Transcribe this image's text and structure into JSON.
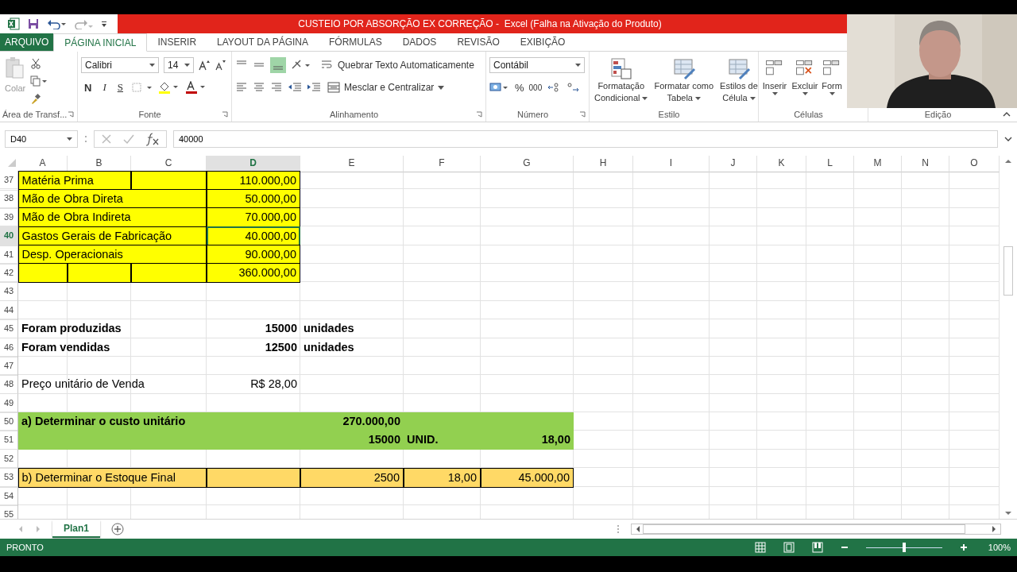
{
  "title_bar": {
    "title": "CUSTEIO POR ABSORÇÃO EX CORREÇÃO -  Excel (Falha na Ativação do Produto)"
  },
  "ribbon_tabs": [
    {
      "label": "ARQUIVO",
      "kind": "file",
      "selected": false
    },
    {
      "label": "PÁGINA INICIAL",
      "kind": "tab",
      "selected": true
    },
    {
      "label": "INSERIR",
      "kind": "tab",
      "selected": false
    },
    {
      "label": "LAYOUT DA PÁGINA",
      "kind": "tab",
      "selected": false
    },
    {
      "label": "FÓRMULAS",
      "kind": "tab",
      "selected": false
    },
    {
      "label": "DADOS",
      "kind": "tab",
      "selected": false
    },
    {
      "label": "REVISÃO",
      "kind": "tab",
      "selected": false
    },
    {
      "label": "EXIBIÇÃO",
      "kind": "tab",
      "selected": false
    }
  ],
  "ribbon": {
    "clipboard": {
      "paste": "Colar",
      "label": "Área de Transf..."
    },
    "font": {
      "name": "Calibri",
      "size": "14",
      "bold": "N",
      "italic": "I",
      "underline": "S",
      "label": "Fonte"
    },
    "alignment": {
      "wrap": "Quebrar Texto Automaticamente",
      "merge": "Mesclar e Centralizar",
      "label": "Alinhamento"
    },
    "number": {
      "format": "Contábil",
      "percent": "%",
      "thousands": "000",
      "label": "Número"
    },
    "styles": {
      "buttons": [
        {
          "line1": "Formatação",
          "line2": "Condicional"
        },
        {
          "line1": "Formatar como",
          "line2": "Tabela"
        },
        {
          "line1": "Estilos de",
          "line2": "Célula"
        }
      ],
      "label": "Estilo"
    },
    "cells": {
      "buttons": [
        "Inserir",
        "Excluir",
        "Form"
      ],
      "label": "Células"
    },
    "editing": {
      "label": "Edição"
    }
  },
  "formula_bar": {
    "name_box": "D40",
    "formula": "40000"
  },
  "sheet": {
    "columns": [
      {
        "label": "A",
        "selected": false
      },
      {
        "label": "B",
        "selected": false
      },
      {
        "label": "C",
        "selected": false
      },
      {
        "label": "D",
        "selected": true
      },
      {
        "label": "E",
        "selected": false
      },
      {
        "label": "F",
        "selected": false
      },
      {
        "label": "G",
        "selected": false
      },
      {
        "label": "H",
        "selected": false
      },
      {
        "label": "I",
        "selected": false
      },
      {
        "label": "J",
        "selected": false
      },
      {
        "label": "K",
        "selected": false
      },
      {
        "label": "L",
        "selected": false
      },
      {
        "label": "M",
        "selected": false
      },
      {
        "label": "N",
        "selected": false
      },
      {
        "label": "O",
        "selected": false
      }
    ],
    "rows": [
      {
        "number": "37",
        "selected": false,
        "cells": [
          {
            "text": "Matéria Prima",
            "kind": "text",
            "color": "#ffff00",
            "border": true
          },
          {
            "merged": true
          },
          {
            "color": "#ffff00",
            "border": true
          },
          {
            "text": "110.000,00",
            "kind": "number",
            "color": "#ffff00",
            "border": true
          }
        ]
      },
      {
        "number": "38",
        "selected": false,
        "cells": [
          {
            "text": "Mão de Obra Direta",
            "kind": "text",
            "color": "#ffff00",
            "border": true
          },
          {
            "merged": true
          },
          {
            "merged": true
          },
          {
            "text": "50.000,00",
            "kind": "number",
            "color": "#ffff00",
            "border": true
          }
        ]
      },
      {
        "number": "39",
        "selected": false,
        "cells": [
          {
            "text": "Mão de Obra Indireta",
            "kind": "text",
            "color": "#ffff00",
            "border": true
          },
          {
            "merged": true
          },
          {
            "merged": true
          },
          {
            "text": "70.000,00",
            "kind": "number",
            "color": "#ffff00",
            "border": true
          }
        ]
      },
      {
        "number": "40",
        "selected": true,
        "cells": [
          {
            "text": "Gastos Gerais de Fabricação",
            "kind": "text",
            "color": "#ffff00",
            "border": true
          },
          {
            "merged": true
          },
          {
            "merged": true
          },
          {
            "text": "40.000,00",
            "kind": "number",
            "color": "#ffff00",
            "border": true
          }
        ]
      },
      {
        "number": "41",
        "selected": false,
        "cells": [
          {
            "text": "Desp. Operacionais",
            "kind": "text",
            "color": "#ffff00",
            "border": true
          },
          {
            "merged": true
          },
          {
            "merged": true
          },
          {
            "text": "90.000,00",
            "kind": "number",
            "color": "#ffff00",
            "border": true
          }
        ]
      },
      {
        "number": "42",
        "selected": false,
        "cells": [
          {
            "color": "#ffff00",
            "border": true
          },
          {
            "color": "#ffff00",
            "border": true
          },
          {
            "color": "#ffff00",
            "border": true
          },
          {
            "text": "360.000,00",
            "kind": "number",
            "color": "#ffff00",
            "border": true
          }
        ]
      },
      {
        "number": "43",
        "selected": false
      },
      {
        "number": "44",
        "selected": false
      },
      {
        "number": "45",
        "selected": false,
        "cells": [
          {
            "text": "Foram produzidas",
            "kind": "text",
            "bold": true
          },
          {
            "merged": true
          },
          {
            "merged": true
          },
          {
            "text": "15000",
            "kind": "number",
            "bold": true
          },
          {
            "text": "unidades",
            "kind": "text",
            "bold": true
          }
        ]
      },
      {
        "number": "46",
        "selected": false,
        "cells": [
          {
            "text": "Foram vendidas",
            "kind": "text",
            "bold": true
          },
          {
            "merged": true
          },
          {
            "merged": true
          },
          {
            "text": "12500",
            "kind": "number",
            "bold": true
          },
          {
            "text": "unidades",
            "kind": "text",
            "bold": true
          }
        ]
      },
      {
        "number": "47",
        "selected": false
      },
      {
        "number": "48",
        "selected": false,
        "cells": [
          {
            "text": "Preço unitário de Venda",
            "kind": "text"
          },
          {
            "merged": true
          },
          {
            "merged": true
          },
          {
            "text": "R$ 28,00",
            "kind": "number"
          }
        ]
      },
      {
        "number": "49",
        "selected": false
      },
      {
        "number": "50",
        "selected": false,
        "cells": [
          {
            "text": "a) Determinar o custo unitário",
            "kind": "text",
            "bold": true,
            "color": "#92d050"
          },
          {
            "merged": true
          },
          {
            "merged": true
          },
          {
            "merged": true
          },
          {
            "text": "270.000,00",
            "kind": "number",
            "bold": true,
            "color": "#92d050"
          },
          {
            "color": "#92d050"
          },
          {
            "color": "#92d050"
          }
        ]
      },
      {
        "number": "51",
        "selected": false,
        "cells": [
          {
            "color": "#92d050"
          },
          {
            "merged": true
          },
          {
            "merged": true
          },
          {
            "merged": true
          },
          {
            "text": "15000",
            "kind": "number",
            "bold": true,
            "color": "#92d050"
          },
          {
            "text": "UNID.",
            "kind": "text",
            "bold": true,
            "color": "#92d050"
          },
          {
            "text": "18,00",
            "kind": "number",
            "bold": true,
            "color": "#92d050"
          }
        ]
      },
      {
        "number": "52",
        "selected": false
      },
      {
        "number": "53",
        "selected": false,
        "cells": [
          {
            "text": "b) Determinar o Estoque Final",
            "kind": "text",
            "color": "#ffd966",
            "border": true
          },
          {
            "merged": true
          },
          {
            "merged": true
          },
          {
            "color": "#ffd966",
            "border": true
          },
          {
            "text": "2500",
            "kind": "number",
            "color": "#ffd966",
            "border": true
          },
          {
            "text": "18,00",
            "kind": "number",
            "color": "#ffd966",
            "border": true
          },
          {
            "text": "45.000,00",
            "kind": "number",
            "color": "#ffd966",
            "border": true
          }
        ]
      },
      {
        "number": "54",
        "selected": false
      },
      {
        "number": "55",
        "selected": false
      }
    ]
  },
  "sheet_tabs": [
    {
      "label": "Plan1",
      "selected": true
    }
  ],
  "status_bar": {
    "status": "PRONTO",
    "zoom": "100%",
    "zoom_level": {
      "level": 0.5
    }
  }
}
